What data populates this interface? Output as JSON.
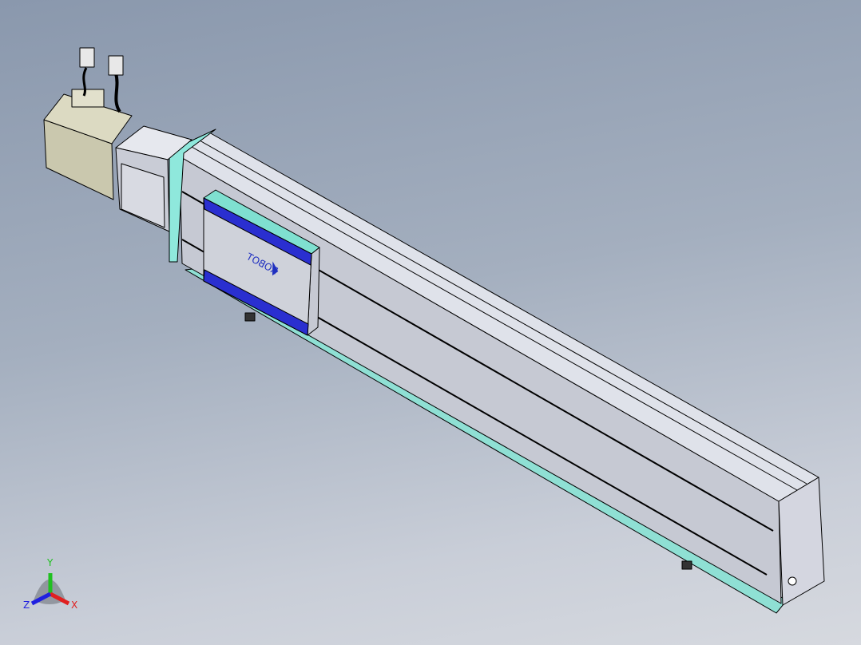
{
  "viewport": {
    "model": "linear-actuator",
    "logo_text": "ROBOT",
    "colors": {
      "carriage_accent": "#2a2fd0",
      "end_plate_accent": "#7fe0d0",
      "beam": "#c9ccd6",
      "motor": "#c8c6ac"
    }
  },
  "triad": {
    "x_label": "X",
    "y_label": "Y",
    "z_label": "Z",
    "x_color": "#e02020",
    "y_color": "#20c020",
    "z_color": "#2020e0"
  }
}
